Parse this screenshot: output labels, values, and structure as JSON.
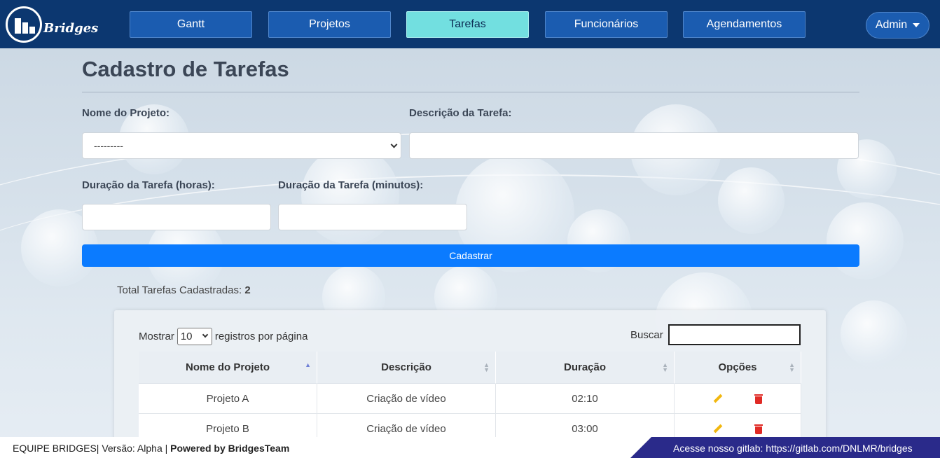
{
  "brand": {
    "name": "Bridges"
  },
  "nav": {
    "items": [
      {
        "label": "Gantt"
      },
      {
        "label": "Projetos"
      },
      {
        "label": "Tarefas"
      },
      {
        "label": "Funcionários"
      },
      {
        "label": "Agendamentos"
      }
    ],
    "active": "Tarefas",
    "admin_label": "Admin"
  },
  "form": {
    "title": "Cadastro de Tarefas",
    "project_label": "Nome do Projeto:",
    "project_value": "---------",
    "description_label": "Descrição da Tarefa:",
    "description_value": "",
    "hours_label": "Duração da Tarefa (horas):",
    "hours_value": "",
    "minutes_label": "Duração da Tarefa (minutos):",
    "minutes_value": "",
    "submit_label": "Cadastrar"
  },
  "summary": {
    "label": "Total Tarefas Cadastradas:",
    "count": "2"
  },
  "table": {
    "show_prefix": "Mostrar",
    "page_size": "10",
    "show_suffix": "registros por página",
    "search_label": "Buscar",
    "search_value": "",
    "columns": [
      "Nome do Projeto",
      "Descrição",
      "Duração",
      "Opções"
    ],
    "rows": [
      {
        "project": "Projeto A",
        "description": "Criação de vídeo",
        "duration": "02:10"
      },
      {
        "project": "Projeto B",
        "description": "Criação de vídeo",
        "duration": "03:00"
      }
    ]
  },
  "footer": {
    "left_prefix": "EQUIPE BRIDGES| Versão: Alpha | ",
    "left_bold": "Powered by BridgesTeam",
    "right": "Acesse nosso gitlab: https://gitlab.com/DNLMR/bridges"
  },
  "colors": {
    "navbar": "#0c3770",
    "nav_button": "#1b5cb0",
    "nav_active": "#72dfe0",
    "primary_button": "#0b7bff",
    "footer_band": "#2a2a8a",
    "edit_icon": "#f2b70f",
    "delete_icon": "#e02a25"
  },
  "icons": {
    "edit": "pencil-icon",
    "delete": "trash-icon",
    "dropdown": "caret-down-icon",
    "sort": "sort-icon"
  }
}
